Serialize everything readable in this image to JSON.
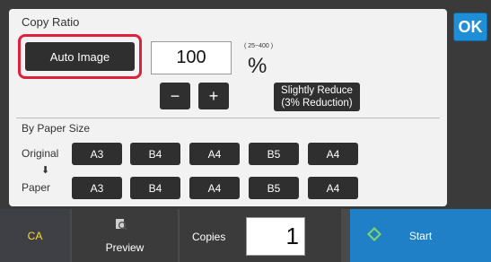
{
  "copy_ratio": {
    "title": "Copy Ratio",
    "auto_image_label": "Auto Image",
    "ratio_value": "100",
    "range_label": "( 25~400 )",
    "percent_symbol": "%",
    "minus_label": "−",
    "plus_label": "+",
    "slightly_reduce_line1": "Slightly Reduce",
    "slightly_reduce_line2": "(3% Reduction)",
    "ok_label": "OK"
  },
  "paper_size": {
    "section_label": "By Paper Size",
    "original_label": "Original",
    "paper_label": "Paper",
    "arrow": "⬇",
    "original_sizes": [
      "A3",
      "B4",
      "A4",
      "B5",
      "A4"
    ],
    "paper_sizes": [
      "A3",
      "B4",
      "A4",
      "B5",
      "A4"
    ]
  },
  "footer": {
    "ca_label": "CA",
    "preview_label": "Preview",
    "preview_icon": "magnifier-icon",
    "copies_label": "Copies",
    "copies_value": "1",
    "start_label": "Start",
    "start_icon": "diamond-icon",
    "start_color": "#1f80c7",
    "ca_color": "#ffdd33"
  },
  "highlight_color": "#e0203a"
}
